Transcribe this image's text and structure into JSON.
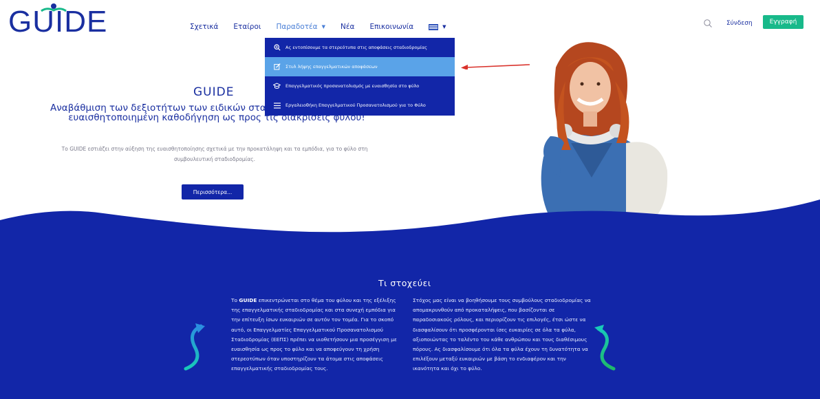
{
  "logo": {
    "text": "GUIDE"
  },
  "nav": {
    "items": [
      {
        "label": "Σχετικά"
      },
      {
        "label": "Εταίροι"
      },
      {
        "label": "Παραδοτέα"
      },
      {
        "label": "Νέα"
      },
      {
        "label": "Επικοινωνία"
      }
    ]
  },
  "header": {
    "login_label": "Σύνδεση",
    "register_label": "Εγγραφή"
  },
  "dropdown": {
    "items": [
      {
        "label": "Ας εντοπίσουμε τα στερεότυπα στις αποφάσεις σταδιοδρομίας",
        "icon": "search-plus-icon"
      },
      {
        "label": "Στυλ λήψης επαγγελματικών αποφάσεων",
        "icon": "edit-icon"
      },
      {
        "label": "Επαγγελματικός προσανατολισμός με ευαισθησία στο φύλο",
        "icon": "graduation-cap-icon"
      },
      {
        "label": "Εργαλειοθήκη Επαγγελματικού Προσανατολισμού για το Φύλο",
        "icon": "list-icon"
      }
    ]
  },
  "hero": {
    "title": "GUIDE",
    "subtitle": "Αναβάθμιση των δεξιοτήτων των ειδικών σταδιοδρομίας με στόχο την ευαισθητοποιημένη καθοδήγηση ως προς τις διακρίσεις φύλου!",
    "description": "Το GUIDE εστιάζει στην αύξηση της ευαισθητοποίησης σχετικά με την προκατάληψη και τα εμπόδια, για το φύλο στη συμβουλευτική σταδιοδρομίας.",
    "button_label": "Περισσότερα..."
  },
  "aims": {
    "title": "Τι στοχεύει",
    "left_bold": "GUIDE",
    "left_prefix": "Το",
    "left_text": "επικεντρώνεται στο θέμα του φύλου και της εξέλιξης της επαγγελματικής σταδιοδρομίας και στα συνεχή εμπόδια για την επίτευξη ίσων ευκαιριών σε αυτόν τον τομέα. Για το σκοπό αυτό, οι Επαγγελματίες Επαγγελματικού Προσανατολισμού Σταδιοδρομίας (ΕΕΠΣ) πρέπει να υιοθετήσουν μια προσέγγιση με ευαισθησία ως προς το φύλο και να αποφεύγουν τη χρήση στερεοτύπων όταν υποστηρίζουν τα άτομα στις αποφάσεις επαγγελματικής σταδιοδρομίας τους.",
    "right_text": "Στόχος μας είναι να βοηθήσουμε τους συμβούλους σταδιοδρομίας να απομακρυνθούν από προκαταλήψεις, που βασίζονται σε παραδοσιακούς ρόλους, και περιορίζουν τις επιλογές, έτσι ώστε να διασφαλίσουν ότι προσφέρονται ίσες ευκαιρίες σε όλα τα φύλα, αξιοποιώντας το ταλέντο του κάθε ανθρώπου και τους διαθέσιμους πόρους. Ας διασφαλίσουμε ότι όλα τα φύλα έχουν τη δυνατότητα να επιλέξουν μεταξύ ευκαιριών με βάση το ενδιαφέρον και την ικανότητα και όχι το φύλο."
  },
  "colors": {
    "brand_blue": "#1226a8",
    "accent_green": "#18b98a",
    "highlight_blue": "#5aa3e8",
    "arrow_red": "#d9322b"
  }
}
